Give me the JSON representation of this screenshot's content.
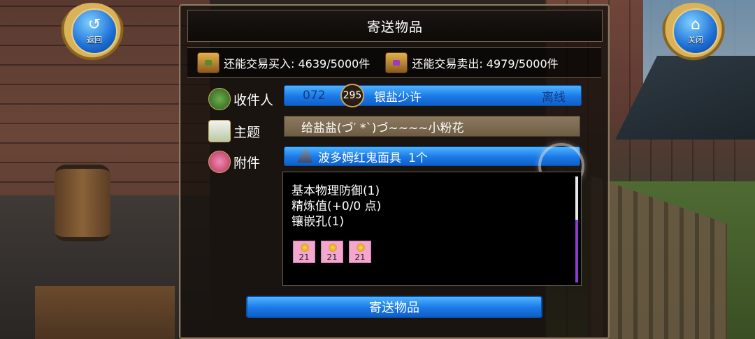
{
  "nav": {
    "back_label": "返回",
    "back_glyph": "↺",
    "close_label": "关闭",
    "close_glyph": "⌂"
  },
  "window": {
    "title": "寄送物品"
  },
  "quota": {
    "buy_label": "还能交易买入: 4639/5000件",
    "sell_label": "还能交易卖出: 4979/5000件"
  },
  "form": {
    "recipient_label": "收件人",
    "recipient_uid": "072",
    "recipient_level": "295",
    "recipient_name": "银盐少许",
    "recipient_status": "离线",
    "subject_label": "主题",
    "subject_value": "给盐盐(づ′ *`)づ~~~~小粉花",
    "attachment_label": "附件",
    "attachment_name": "波多姆红鬼面具",
    "attachment_count": "1个"
  },
  "item_details": {
    "lines": [
      "基本物理防御(1)",
      "精炼值(+0/0 点)",
      "镶嵌孔(1)"
    ],
    "gems": [
      "21",
      "21",
      "21"
    ]
  },
  "actions": {
    "send_label": "寄送物品"
  },
  "colors": {
    "accent_blue": "#1a78e6",
    "subject_bg": "#7d6c51",
    "gem_pink": "#f4a6d0",
    "scroll_thumb": "#8a3cd0"
  }
}
